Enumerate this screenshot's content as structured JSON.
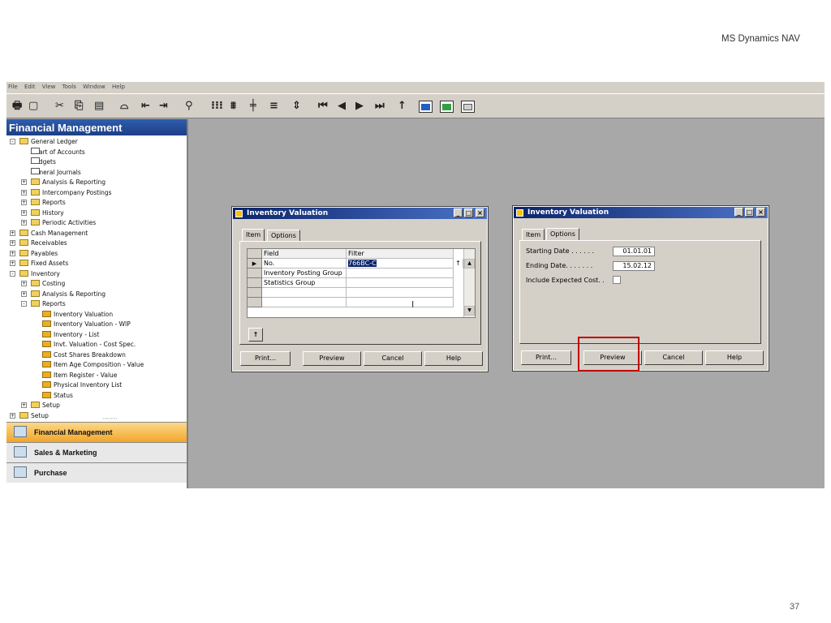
{
  "slide": {
    "title": "MS Dynamics NAV",
    "page_number": "37"
  },
  "menubar": [
    "File",
    "Edit",
    "View",
    "Tools",
    "Window",
    "Help"
  ],
  "toolbar_icons": [
    "print-icon",
    "print-preview-icon",
    "cut-icon",
    "copy-icon",
    "paste-icon",
    "attach-icon",
    "indent-icon",
    "outdent-icon",
    "find-icon",
    "list-icon",
    "card-icon",
    "add-line-icon",
    "filter-icon",
    "sort-icon",
    "first-record-icon",
    "previous-record-icon",
    "next-record-icon",
    "last-record-icon",
    "up-icon",
    "grid1-icon",
    "grid2-icon",
    "grid3-icon"
  ],
  "nav": {
    "header": "Financial Management",
    "tree": [
      {
        "label": "General Ledger",
        "level": 0,
        "icon": "folder-open",
        "exp": "-"
      },
      {
        "label": "Chart of Accounts",
        "level": 1,
        "icon": "grid"
      },
      {
        "label": "Budgets",
        "level": 1,
        "icon": "grid"
      },
      {
        "label": "General Journals",
        "level": 1,
        "icon": "grid"
      },
      {
        "label": "Analysis & Reporting",
        "level": 1,
        "icon": "folder",
        "exp": "+"
      },
      {
        "label": "Intercompany Postings",
        "level": 1,
        "icon": "folder",
        "exp": "+"
      },
      {
        "label": "Reports",
        "level": 1,
        "icon": "folder",
        "exp": "+"
      },
      {
        "label": "History",
        "level": 1,
        "icon": "folder",
        "exp": "+"
      },
      {
        "label": "Periodic Activities",
        "level": 1,
        "icon": "folder",
        "exp": "+"
      },
      {
        "label": "Cash Management",
        "level": 0,
        "icon": "folder",
        "exp": "+"
      },
      {
        "label": "Receivables",
        "level": 0,
        "icon": "folder",
        "exp": "+"
      },
      {
        "label": "Payables",
        "level": 0,
        "icon": "folder",
        "exp": "+"
      },
      {
        "label": "Fixed Assets",
        "level": 0,
        "icon": "folder",
        "exp": "+"
      },
      {
        "label": "Inventory",
        "level": 0,
        "icon": "folder-open",
        "exp": "-"
      },
      {
        "label": "Costing",
        "level": 1,
        "icon": "folder",
        "exp": "+"
      },
      {
        "label": "Analysis & Reporting",
        "level": 1,
        "icon": "folder",
        "exp": "+"
      },
      {
        "label": "Reports",
        "level": 1,
        "icon": "folder-open",
        "exp": "-"
      },
      {
        "label": "Inventory Valuation",
        "level": 2,
        "icon": "report"
      },
      {
        "label": "Inventory Valuation - WIP",
        "level": 2,
        "icon": "report"
      },
      {
        "label": "Inventory - List",
        "level": 2,
        "icon": "report"
      },
      {
        "label": "Invt. Valuation - Cost Spec.",
        "level": 2,
        "icon": "report"
      },
      {
        "label": "Cost Shares Breakdown",
        "level": 2,
        "icon": "report"
      },
      {
        "label": "Item Age Composition - Value",
        "level": 2,
        "icon": "report"
      },
      {
        "label": "Item Register - Value",
        "level": 2,
        "icon": "report"
      },
      {
        "label": "Physical Inventory List",
        "level": 2,
        "icon": "report"
      },
      {
        "label": "Status",
        "level": 2,
        "icon": "report"
      },
      {
        "label": "Setup",
        "level": 1,
        "icon": "folder",
        "exp": "+"
      },
      {
        "label": "Setup",
        "level": 0,
        "icon": "folder",
        "exp": "+"
      }
    ],
    "buttons": [
      {
        "label": "Financial Management",
        "active": true
      },
      {
        "label": "Sales & Marketing",
        "active": false
      },
      {
        "label": "Purchase",
        "active": false
      }
    ]
  },
  "dialog_item": {
    "title": "Inventory Valuation",
    "tabs": [
      "Item",
      "Options"
    ],
    "columns": [
      "Field",
      "Filter"
    ],
    "rows": [
      {
        "field": "No.",
        "filter": "766BC-C"
      },
      {
        "field": "Inventory Posting Group",
        "filter": ""
      },
      {
        "field": "Statistics Group",
        "filter": ""
      },
      {
        "field": "",
        "filter": ""
      },
      {
        "field": "",
        "filter": ""
      }
    ],
    "buttons": [
      "Print...",
      "Preview",
      "Cancel",
      "Help"
    ]
  },
  "dialog_options": {
    "title": "Inventory Valuation",
    "tabs": [
      "Item",
      "Options"
    ],
    "starting_date_label": "Starting Date . . . . . .",
    "starting_date": "01.01.01",
    "ending_date_label": "Ending Date. . . . . . .",
    "ending_date": "15.02.12",
    "expected_cost_label": "Include Expected Cost. .",
    "buttons": [
      "Print...",
      "Preview",
      "Cancel",
      "Help"
    ]
  }
}
